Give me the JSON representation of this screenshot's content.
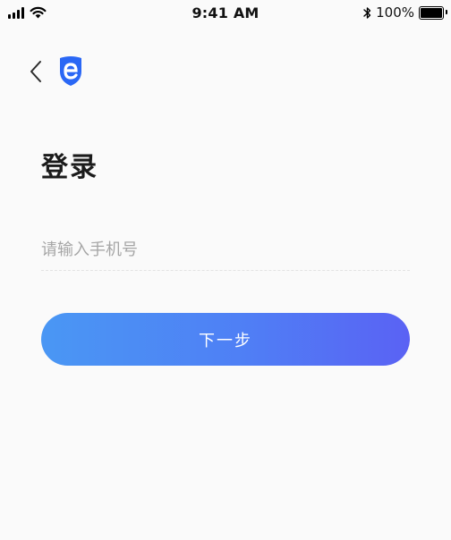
{
  "status_bar": {
    "time": "9:41 AM",
    "battery": "100%",
    "battery_level": 1.0,
    "icons": [
      "signal-icon",
      "wifi-icon",
      "bluetooth-icon",
      "battery-icon"
    ]
  },
  "nav": {
    "back_icon": "chevron-left-icon",
    "logo_icon": "shield-e-logo"
  },
  "page": {
    "title": "登录"
  },
  "form": {
    "phone_placeholder": "请输入手机号",
    "phone_value": ""
  },
  "actions": {
    "next_label": "下一步"
  },
  "colors": {
    "accent_start": "#4a97f4",
    "accent_end": "#5a62f4",
    "logo": "#2a67f5"
  }
}
